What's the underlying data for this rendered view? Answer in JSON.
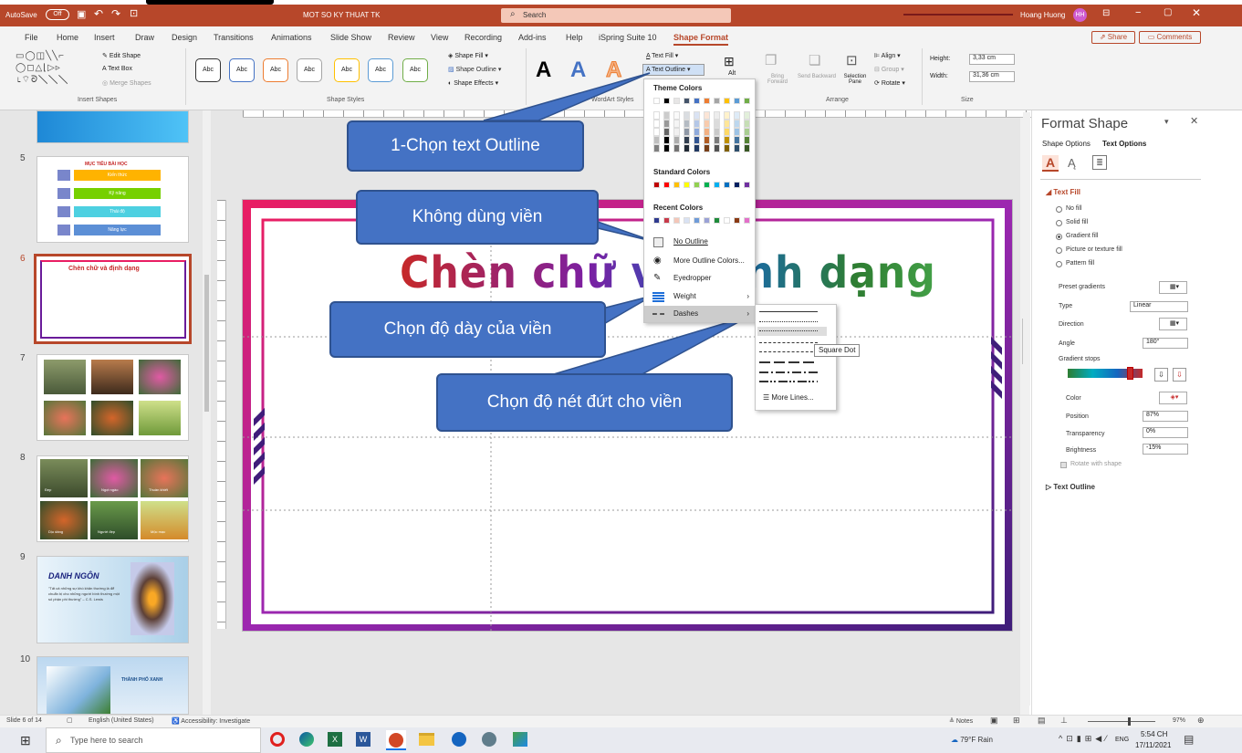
{
  "title_bar": {
    "autosave_label": "AutoSave",
    "autosave_state": "Off",
    "file_name": "MOT SO KY THUAT TK",
    "search_placeholder": "Search",
    "user_name": "Hoang Huong",
    "user_initials": "HH"
  },
  "ribbon_tabs": [
    "File",
    "Home",
    "Insert",
    "Draw",
    "Design",
    "Transitions",
    "Animations",
    "Slide Show",
    "Review",
    "View",
    "Recording",
    "Add-ins",
    "Help",
    "iSpring Suite 10",
    "Shape Format"
  ],
  "active_tab": "Shape Format",
  "share_label": "Share",
  "comments_label": "Comments",
  "ribbon": {
    "edit_shape": "Edit Shape",
    "text_box": "Text Box",
    "merge_shapes": "Merge Shapes",
    "insert_shapes": "Insert Shapes",
    "style_abc": "Abc",
    "shape_fill": "Shape Fill",
    "shape_outline": "Shape Outline",
    "shape_effects": "Shape Effects",
    "shape_styles": "Shape Styles",
    "wordart_letter": "A",
    "text_fill": "Text Fill",
    "text_outline": "Text Outline",
    "wordart_styles": "WordArt Styles",
    "alt_text": "Alt",
    "bring_forward": "Bring Forward",
    "send_backward": "Send Backward",
    "selection_pane": "Selection Pane",
    "align": "Align",
    "group": "Group",
    "rotate": "Rotate",
    "arrange": "Arrange",
    "height_label": "Height:",
    "height_value": "3,33 cm",
    "width_label": "Width:",
    "width_value": "31,36 cm",
    "size": "Size"
  },
  "thumbnails": [
    {
      "num": "5",
      "title": "MỤC TIÊU BÀI HỌC",
      "items": [
        "Kiến thức",
        "Kỹ năng",
        "Thái độ",
        "Năng lực"
      ]
    },
    {
      "num": "6",
      "title": "Chèn chữ và định dạng"
    },
    {
      "num": "7"
    },
    {
      "num": "8",
      "captions": [
        "Đẹp",
        "Ngọt ngào",
        "Thuần khiết",
        "Dịu dàng",
        "Người đẹp",
        "Mộc mạc"
      ]
    },
    {
      "num": "9",
      "title": "DANH NGÔN",
      "quote": "\"Tất cả những sự khó khăn thường là để chuẩn bị cho những người bình thường một số phận phi thường\" – C.S. Lewis"
    },
    {
      "num": "10",
      "title": "THÀNH PHỐ XANH"
    }
  ],
  "slide": {
    "title": "Chèn chữ và định dạng"
  },
  "callouts": {
    "c1": "1-Chọn text Outline",
    "c2": "Không dùng viền",
    "c3": "Chọn độ dày của viền",
    "c4": "Chọn độ nét đứt cho viền"
  },
  "outline_menu": {
    "theme_colors": "Theme Colors",
    "standard_colors": "Standard Colors",
    "recent_colors": "Recent Colors",
    "no_outline": "No Outline",
    "more_colors": "More Outline Colors...",
    "eyedropper": "Eyedropper",
    "weight": "Weight",
    "dashes": "Dashes",
    "theme_palette": [
      "#ffffff",
      "#000000",
      "#e7e6e6",
      "#44546a",
      "#4472c4",
      "#ed7d31",
      "#a5a5a5",
      "#ffc000",
      "#5b9bd5",
      "#70ad47"
    ],
    "standard_palette": [
      "#c00000",
      "#ff0000",
      "#ffc000",
      "#ffff00",
      "#92d050",
      "#00b050",
      "#00b0f0",
      "#0070c0",
      "#002060",
      "#7030a0"
    ],
    "recent_palette": [
      "#2f3a8f",
      "#c83a4a",
      "#f4c6b8",
      "#d9e2f3",
      "#6f9bd8",
      "#9aa2d6",
      "#1e8b3a",
      "#ffffff",
      "#8a3a14",
      "#e36fc9"
    ]
  },
  "dashes_menu": {
    "tooltip": "Square Dot",
    "more_lines": "More Lines..."
  },
  "format_pane": {
    "title": "Format Shape",
    "tab_shape": "Shape Options",
    "tab_text": "Text Options",
    "section_fill": "Text Fill",
    "no_fill": "No fill",
    "solid_fill": "Solid fill",
    "gradient_fill": "Gradient fill",
    "picture_fill": "Picture or texture fill",
    "pattern_fill": "Pattern fill",
    "preset": "Preset gradients",
    "type": "Type",
    "type_value": "Linear",
    "direction": "Direction",
    "angle": "Angle",
    "angle_value": "180°",
    "stops": "Gradient stops",
    "color": "Color",
    "position": "Position",
    "position_value": "87%",
    "transparency": "Transparency",
    "transparency_value": "0%",
    "brightness": "Brightness",
    "brightness_value": "-15%",
    "rotate": "Rotate with shape",
    "section_outline": "Text Outline"
  },
  "status_bar": {
    "slide_info": "Slide 6 of 14",
    "language": "English (United States)",
    "accessibility": "Accessibility: Investigate",
    "notes": "Notes",
    "zoom": "97%"
  },
  "taskbar": {
    "search_placeholder": "Type here to search",
    "weather": "79°F Rain",
    "lang": "ENG",
    "time": "5:54 CH",
    "date": "17/11/2021"
  }
}
